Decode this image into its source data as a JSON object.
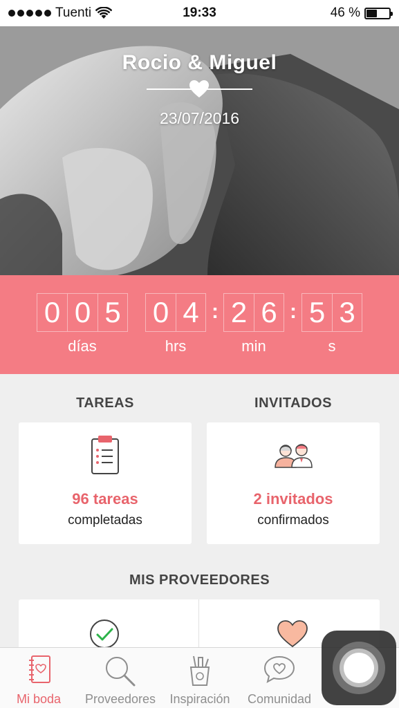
{
  "status_bar": {
    "carrier": "Tuenti",
    "time": "19:33",
    "battery_text": "46 %",
    "battery_level": 0.46
  },
  "hero": {
    "names": "Rocio & Miguel",
    "date": "23/07/2016"
  },
  "countdown": {
    "days_digits": [
      "0",
      "0",
      "5"
    ],
    "hours_digits": [
      "0",
      "4"
    ],
    "minutes_digits": [
      "2",
      "6"
    ],
    "seconds_digits": [
      "5",
      "3"
    ],
    "separator": ":",
    "days_label": "días",
    "hours_label": "hrs",
    "minutes_label": "min",
    "seconds_label": "s"
  },
  "tasks": {
    "title": "TAREAS",
    "count": "96 tareas",
    "subtitle": "completadas"
  },
  "guests": {
    "title": "INVITADOS",
    "count": "2 invitados",
    "subtitle": "confirmados"
  },
  "vendors": {
    "title": "MIS PROVEEDORES"
  },
  "tabs": [
    {
      "label": "Mi boda",
      "icon": "notebook-icon",
      "active": true
    },
    {
      "label": "Proveedores",
      "icon": "search-icon",
      "active": false
    },
    {
      "label": "Inspiración",
      "icon": "tools-cup-icon",
      "active": false
    },
    {
      "label": "Comunidad",
      "icon": "chat-heart-icon",
      "active": false
    }
  ],
  "colors": {
    "accent": "#f47c84",
    "accent_text": "#e8646c",
    "background": "#efefef"
  }
}
